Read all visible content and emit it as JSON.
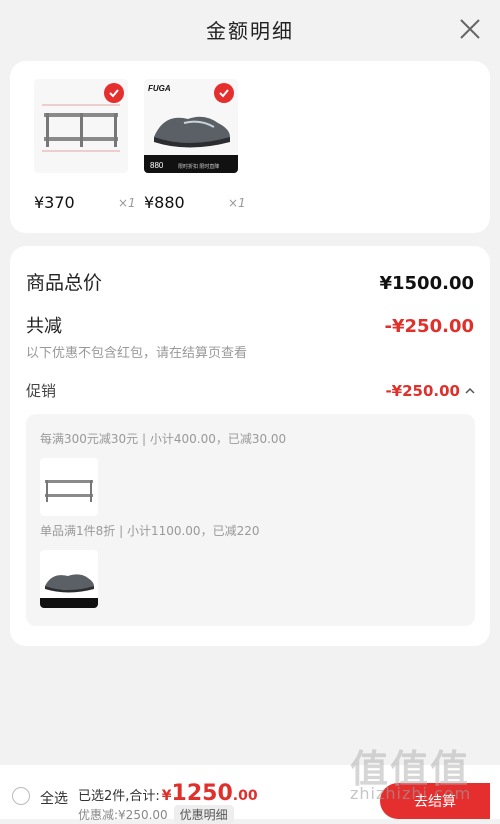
{
  "header": {
    "title": "金额明细",
    "close_icon": "close-icon"
  },
  "products": [
    {
      "price": "¥370",
      "qty": "×1",
      "icon": "steel-shelf-image",
      "checked": true
    },
    {
      "price": "¥880",
      "qty": "×1",
      "icon": "running-shoe-image",
      "checked": true,
      "brand": "FUGA",
      "tag_price": "880",
      "tag_text": "限时折扣 限时直降"
    }
  ],
  "detail": {
    "total_label": "商品总价",
    "total_value": "¥1500.00",
    "discount_label": "共减",
    "discount_value": "-¥250.00",
    "note": "以下优惠不包含红包，请在结算页查看",
    "promo_label": "促销",
    "promo_value": "-¥250.00",
    "promo_rules": [
      {
        "text": "每满300元减30元 | 小计400.00，已减30.00"
      },
      {
        "text": "单品满1件8折 | 小计1100.00，已减220"
      }
    ]
  },
  "footer": {
    "select_all": "全选",
    "summary_prefix": "已选2件,合计:",
    "total_yen": "¥",
    "total_int": "1250",
    "total_dec": ".00",
    "discount_text": "优惠减:¥250.00",
    "detail_button": "优惠明细",
    "checkout": "去结算"
  },
  "watermark": {
    "main": "值值值",
    "sub": "zhizhizhi.com"
  },
  "colors": {
    "accent": "#e52e2e",
    "background": "#f2f2f2"
  }
}
